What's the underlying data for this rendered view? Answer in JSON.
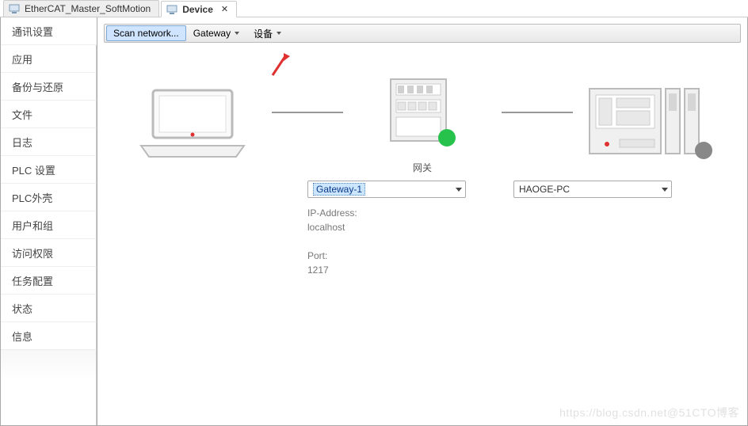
{
  "tabs": [
    {
      "label": "EtherCAT_Master_SoftMotion",
      "active": false
    },
    {
      "label": "Device",
      "active": true
    }
  ],
  "sidebar": {
    "items": [
      "通讯设置",
      "应用",
      "备份与还原",
      "文件",
      "日志",
      "PLC 设置",
      "PLC外壳",
      "用户和组",
      "访问权限",
      "任务配置",
      "状态",
      "信息"
    ],
    "selected_index": 0
  },
  "toolbar": {
    "scan": "Scan network...",
    "gateway": "Gateway",
    "devices": "设备"
  },
  "diagram": {
    "gateway_label": "网关",
    "gateway_select": "Gateway-1",
    "device_select": "HAOGE-PC",
    "ip_label": "IP-Address:",
    "ip_value": "localhost",
    "port_label": "Port:",
    "port_value": "1217"
  },
  "watermark": "https://blog.csdn.net@51CTO博客"
}
